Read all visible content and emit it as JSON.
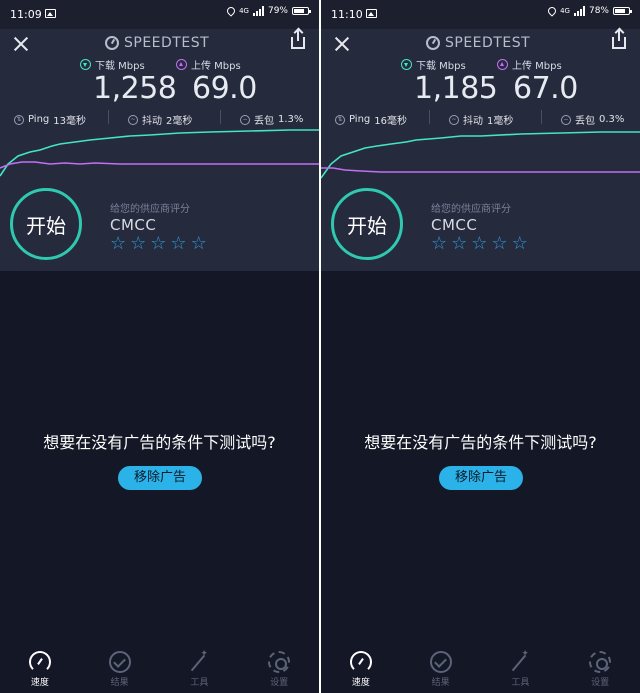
{
  "colors": {
    "background": "#141726",
    "panel": "#262a3d",
    "download": "#43e5c6",
    "upload": "#c070f2",
    "accent": "#2bb2e8",
    "start_ring": "#2fc9b1"
  },
  "app": {
    "title": "SPEEDTEST"
  },
  "screens": [
    {
      "statusbar": {
        "time": "11:09",
        "battery": "79%",
        "battery_level": 0.79,
        "network": "4G"
      },
      "download": {
        "label": "下载 Mbps",
        "value": "1,258"
      },
      "upload": {
        "label": "上传 Mbps",
        "value": "69.0"
      },
      "ping": {
        "label": "Ping",
        "value": "13毫秒"
      },
      "jitter": {
        "label": "抖动",
        "value": "2毫秒"
      },
      "loss": {
        "label": "丢包",
        "value": "1.3%"
      },
      "start_label": "开始",
      "provider": {
        "label": "给您的供应商评分",
        "name": "CMCC"
      },
      "ad": {
        "question": "想要在没有广告的条件下测试吗?",
        "button": "移除广告"
      },
      "tabs": [
        {
          "label": "速度",
          "icon": "speedometer-icon",
          "active": true
        },
        {
          "label": "结果",
          "icon": "checkmark-icon",
          "active": false
        },
        {
          "label": "工具",
          "icon": "magic-wand-icon",
          "active": false
        },
        {
          "label": "设置",
          "icon": "gear-icon",
          "active": false
        }
      ]
    },
    {
      "statusbar": {
        "time": "11:10",
        "battery": "78%",
        "battery_level": 0.78,
        "network": "4G"
      },
      "download": {
        "label": "下载 Mbps",
        "value": "1,185"
      },
      "upload": {
        "label": "上传 Mbps",
        "value": "67.0"
      },
      "ping": {
        "label": "Ping",
        "value": "16毫秒"
      },
      "jitter": {
        "label": "抖动",
        "value": "1毫秒"
      },
      "loss": {
        "label": "丢包",
        "value": "0.3%"
      },
      "start_label": "开始",
      "provider": {
        "label": "给您的供应商评分",
        "name": "CMCC"
      },
      "ad": {
        "question": "想要在没有广告的条件下测试吗?",
        "button": "移除广告"
      },
      "tabs": [
        {
          "label": "速度",
          "icon": "speedometer-icon",
          "active": true
        },
        {
          "label": "结果",
          "icon": "checkmark-icon",
          "active": false
        },
        {
          "label": "工具",
          "icon": "magic-wand-icon",
          "active": false
        },
        {
          "label": "设置",
          "icon": "gear-icon",
          "active": false
        }
      ]
    }
  ]
}
